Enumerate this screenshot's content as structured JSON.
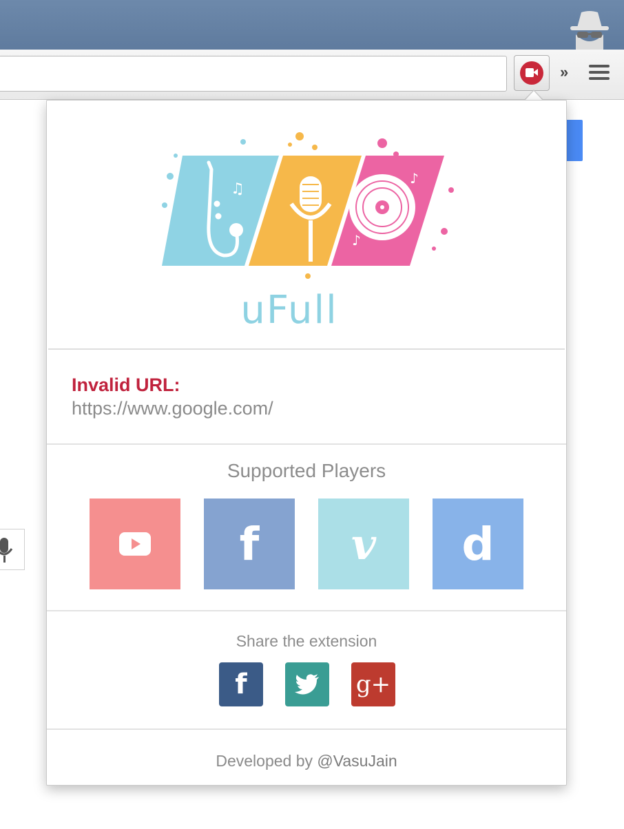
{
  "browser": {
    "extension_icon": "record-camera-icon",
    "overflow_icon": "chevron-double-right-icon",
    "overflow_label": "»",
    "menu_icon": "hamburger-menu-icon",
    "incognito_icon": "incognito-spy-icon",
    "colors": {
      "titlebar": "#6d89ab",
      "extension": "#c9283a"
    }
  },
  "popup": {
    "logo": {
      "text": "uFull",
      "icons": [
        "saxophone-icon",
        "microphone-icon",
        "vinyl-record-icon"
      ],
      "colors": [
        "#8fd3e4",
        "#f6b84a",
        "#ec64a3"
      ]
    },
    "status": {
      "label": "Invalid URL:",
      "url": "https://www.google.com/",
      "label_color": "#c0223d"
    },
    "players": {
      "title": "Supported Players",
      "items": [
        {
          "name": "YouTube",
          "icon": "youtube-icon",
          "glyph": "▶",
          "color": "#f58f8f"
        },
        {
          "name": "Facebook",
          "icon": "facebook-icon",
          "glyph": "f",
          "color": "#85a3d0"
        },
        {
          "name": "Vimeo",
          "icon": "vimeo-icon",
          "glyph": "v",
          "color": "#abdfe7"
        },
        {
          "name": "Dailymotion",
          "icon": "dailymotion-icon",
          "glyph": "d",
          "color": "#88b3e9"
        }
      ]
    },
    "share": {
      "title": "Share the extension",
      "items": [
        {
          "name": "Facebook",
          "icon": "facebook-icon",
          "glyph": "f",
          "color": "#3b5b87"
        },
        {
          "name": "Twitter",
          "icon": "twitter-bird-icon",
          "glyph": "",
          "color": "#3a9d94"
        },
        {
          "name": "Google+",
          "icon": "google-plus-icon",
          "glyph": "g+",
          "color": "#bd3b2f"
        }
      ]
    },
    "footer": {
      "prefix": "Developed by ",
      "handle": "@VasuJain"
    }
  }
}
